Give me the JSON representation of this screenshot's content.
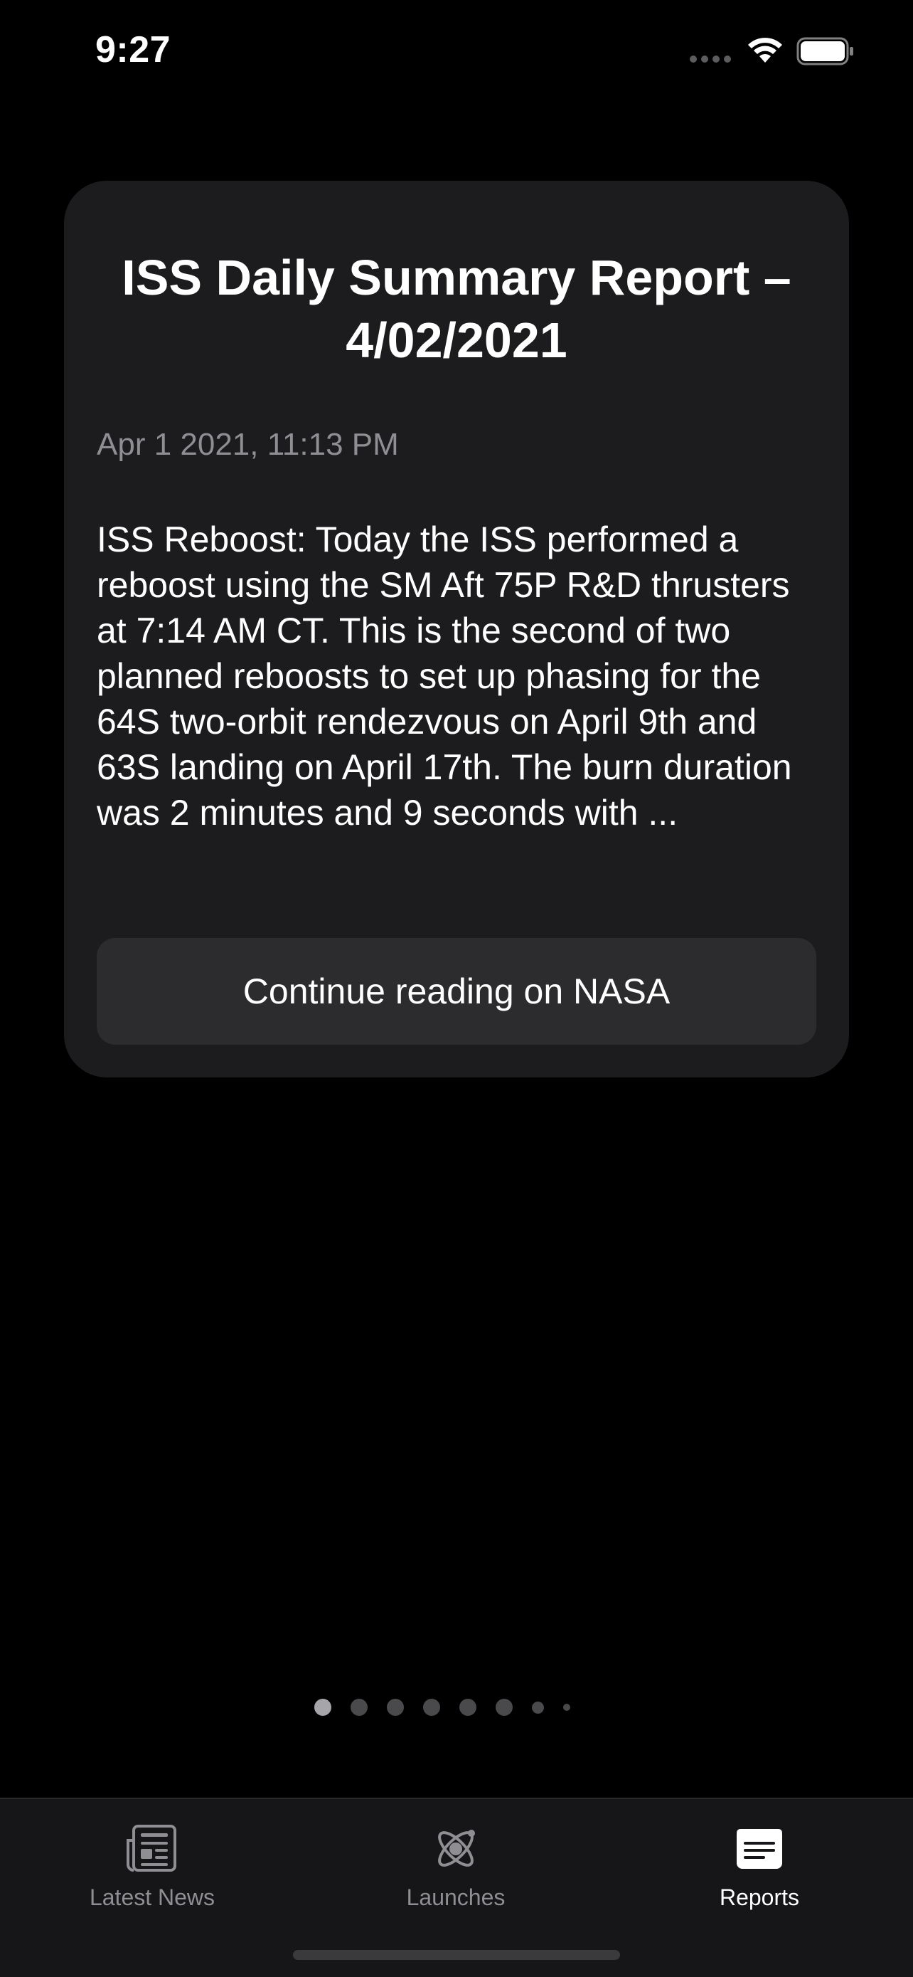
{
  "status_bar": {
    "time": "9:27"
  },
  "card": {
    "title": "ISS Daily Summary Report – 4/02/2021",
    "date": "Apr 1 2021, 11:13 PM",
    "body": "ISS Reboost: Today the ISS performed a reboost using the SM Aft 75P R&D thrusters at 7:14 AM CT. This is the second of two planned reboosts to set up phasing for the 64S two-orbit rendezvous on April 9th and 63S landing on April 17th. The burn duration was 2 minutes and 9 seconds with ...",
    "button_label": "Continue reading on NASA"
  },
  "pager": {
    "page_count": 8,
    "current_page": 1
  },
  "tab_bar": {
    "tabs": [
      {
        "label": "Latest News",
        "icon": "newspaper-icon",
        "active": false
      },
      {
        "label": "Launches",
        "icon": "satellite-icon",
        "active": false
      },
      {
        "label": "Reports",
        "icon": "report-icon",
        "active": true
      }
    ]
  },
  "colors": {
    "background": "#000000",
    "card": "#1c1c1e",
    "button": "#2c2c2e",
    "secondary_text": "#8e8e93",
    "tab_bar": "#161618"
  }
}
